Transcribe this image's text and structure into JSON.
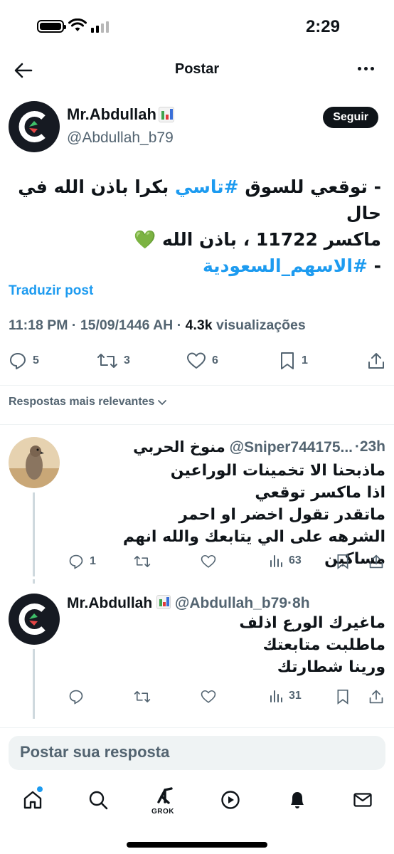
{
  "status_bar": {
    "time": "2:29"
  },
  "nav": {
    "title": "Postar",
    "back_icon": "arrow-left-icon",
    "more_icon": "more-horizontal-icon"
  },
  "post": {
    "author": {
      "name": "Mr.Abdullah",
      "handle": "@Abdullah_b79"
    },
    "follow_label": "Seguir",
    "body": {
      "line1_prefix": "- توقعي للسوق ",
      "line1_hashtag": "#تاسي",
      "line1_suffix": " بكرا باذن الله في حال",
      "line2_text": "ماكسر 11722 ، باذن الله ",
      "line2_emoji": "💚",
      "line3_prefix": "- ",
      "line3_hashtag": "#الاسهم_السعودية"
    },
    "translate_label": "Traduzir post",
    "meta": {
      "time": "11:18 PM",
      "separator": " · ",
      "date": "15/09/1446 AH",
      "views_count": "4.3k",
      "views_label": " visualizações"
    },
    "actions": {
      "replies": "5",
      "reposts": "3",
      "likes": "6",
      "bookmarks": "1"
    }
  },
  "replies_sort_label": "Respostas mais relevantes",
  "replies": [
    {
      "name": "منوخ الحربي",
      "handle": "@Sniper744175...",
      "time": "23h",
      "lines": [
        "ماذبحنا الا تخمينات الوراعين",
        "اذا ماكسر توقعي",
        "ماتقدر تقول اخضر او احمر",
        "الشرهه على الي يتابعك والله انهم مساكين"
      ],
      "replies": "1",
      "views": "63"
    },
    {
      "name": "Mr.Abdullah",
      "handle": "@Abdullah_b79",
      "time": "8h",
      "lines": [
        "ماغيرك الورع اذلف",
        "ماطلبت متابعتك",
        "ورينا شطارتك"
      ],
      "views": "31"
    }
  ],
  "composer": {
    "placeholder": "Postar sua resposta"
  },
  "tab_bar": {
    "grok_label": "GROK"
  },
  "colors": {
    "accent": "#1d9bf0",
    "text": "#0f1419",
    "muted": "#536471",
    "avatar_bg": "#161a22"
  }
}
